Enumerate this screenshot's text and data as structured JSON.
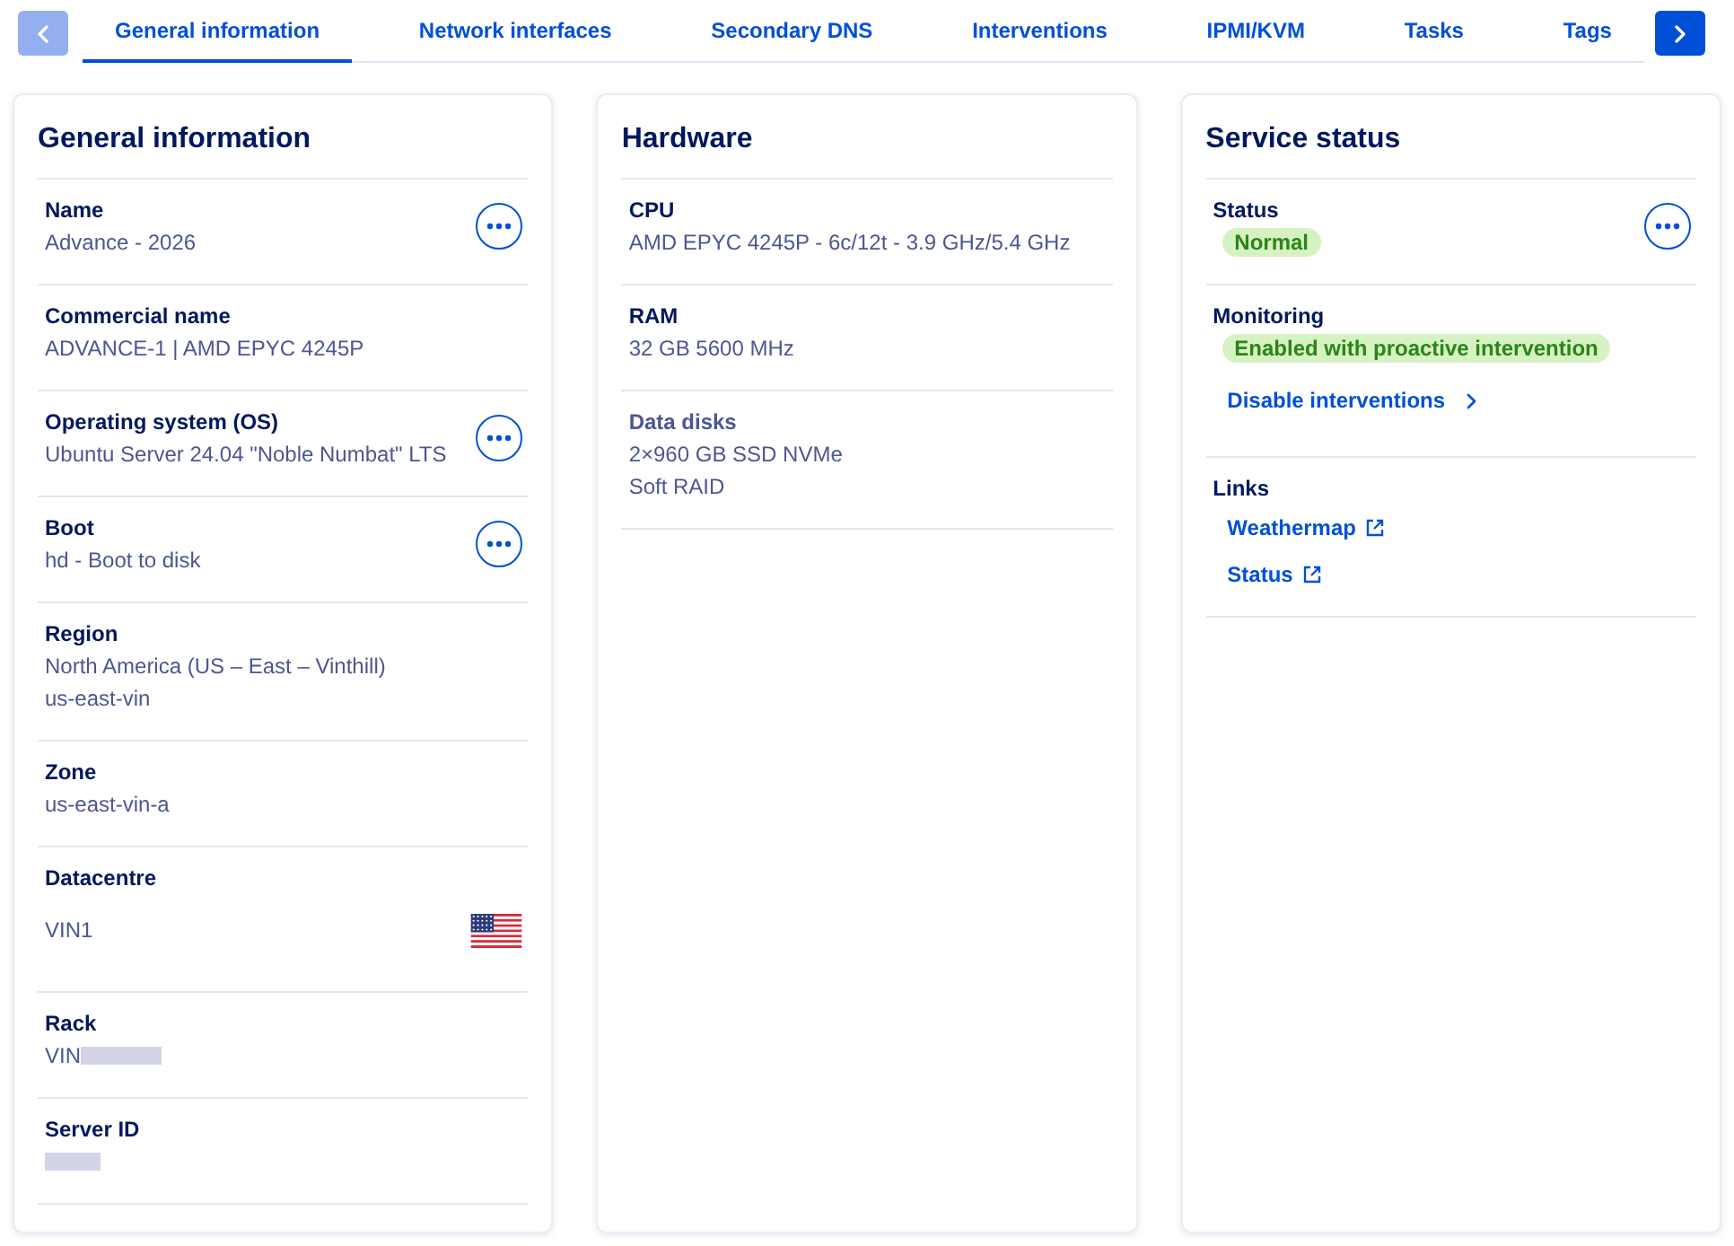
{
  "tab_bar": {
    "scroll_buttons": [
      {
        "kind": "previous",
        "disabled": true
      },
      {
        "kind": "next",
        "disabled": false
      }
    ],
    "tabs": [
      {
        "label": "General information",
        "selected": true
      },
      {
        "label": "Network interfaces",
        "selected": false
      },
      {
        "label": "Secondary DNS",
        "selected": false
      },
      {
        "label": "Interventions",
        "selected": false
      },
      {
        "label": "IPMI/KVM",
        "selected": false
      },
      {
        "label": "Tasks",
        "selected": false
      },
      {
        "label": "Tags",
        "selected": false
      }
    ]
  },
  "cards": [
    {
      "title": "General information",
      "rows": [
        {
          "label": "Name",
          "kind": "action",
          "lines": [
            "Advance - 2026"
          ]
        },
        {
          "label": "Commercial name",
          "kind": "plain",
          "lines": [
            "ADVANCE-1 | AMD EPYC 4245P"
          ]
        },
        {
          "label": "Operating system (OS)",
          "kind": "action",
          "lines": [
            "Ubuntu Server 24.04 \"Noble Numbat\" LTS"
          ]
        },
        {
          "label": "Boot",
          "kind": "action",
          "lines": [
            "hd - Boot to disk"
          ]
        },
        {
          "label": "Region",
          "kind": "plain",
          "lines": [
            "North America (US – East – Vinthill)",
            "us-east-vin"
          ]
        },
        {
          "label": "Zone",
          "kind": "plain",
          "lines": [
            "us-east-vin-a"
          ]
        },
        {
          "label": "Datacentre",
          "kind": "flag",
          "lines": [
            "VIN1"
          ]
        },
        {
          "label": "Rack",
          "kind": "redacted",
          "lines": [
            "VIN"
          ]
        },
        {
          "label": "Server ID",
          "kind": "redacted"
        }
      ]
    },
    {
      "title": "Hardware",
      "rows": [
        {
          "label": "CPU",
          "kind": "plain",
          "muted": false,
          "lines": [
            "AMD EPYC 4245P - 6c/12t - 3.9 GHz/5.4 GHz"
          ]
        },
        {
          "label": "RAM",
          "kind": "plain",
          "muted": false,
          "lines": [
            "32 GB 5600 MHz"
          ]
        },
        {
          "label": "Data disks",
          "kind": "plain",
          "muted": true,
          "lines": [
            "2×960 GB SSD NVMe",
            "Soft RAID"
          ]
        }
      ]
    },
    {
      "title": "Service status",
      "rows": [
        {
          "label": "Status",
          "kind": "action",
          "badges": [
            "Normal"
          ]
        },
        {
          "label": "Monitoring",
          "kind": "plain",
          "badges": [
            "Enabled with proactive intervention"
          ],
          "links": [
            {
              "text": "Disable interventions",
              "kind": "internal"
            }
          ]
        },
        {
          "label": "Links",
          "kind": "plain",
          "links": [
            {
              "text": "Weathermap",
              "kind": "external"
            },
            {
              "text": "Status",
              "kind": "external"
            }
          ]
        }
      ]
    }
  ]
}
